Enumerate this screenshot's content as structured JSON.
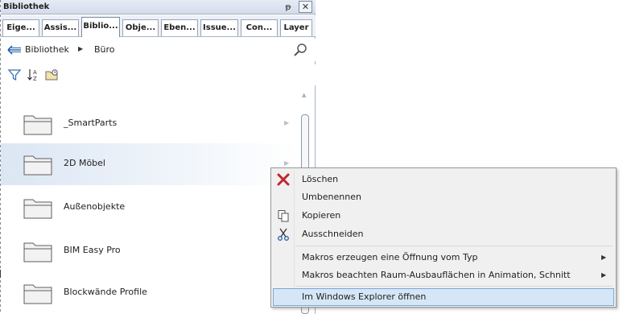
{
  "panel": {
    "title": "Bibliothek",
    "pin_glyph": "ᵽ",
    "close_glyph": "✕",
    "tabs": [
      {
        "label": "Eige...",
        "active": false
      },
      {
        "label": "Assis...",
        "active": false
      },
      {
        "label": "Biblio...",
        "active": true
      },
      {
        "label": "Obje...",
        "active": false
      },
      {
        "label": "Eben...",
        "active": false
      },
      {
        "label": "Issue...",
        "active": false
      },
      {
        "label": "Con...",
        "active": false
      },
      {
        "label": "Layer",
        "active": false
      }
    ]
  },
  "breadcrumb": {
    "items": [
      "Bibliothek",
      "Büro"
    ],
    "separator": "▶",
    "back_icon": "back-arrow-icon",
    "search_icon": "search-icon"
  },
  "toolbar": {
    "icons": [
      "filter-icon",
      "sort-icon",
      "folder-settings-icon"
    ]
  },
  "folders": [
    {
      "label": "_SmartParts",
      "hovered": false
    },
    {
      "label": "2D Möbel",
      "hovered": true
    },
    {
      "label": "Außenobjekte",
      "hovered": false
    },
    {
      "label": "BIM Easy Pro",
      "hovered": false
    },
    {
      "label": "Blockwände Profile",
      "hovered": false
    }
  ],
  "context_menu": {
    "items": [
      {
        "label": "Löschen",
        "icon": "delete-x-icon",
        "submenu": false,
        "selected": false
      },
      {
        "label": "Umbenennen",
        "icon": "",
        "submenu": false,
        "selected": false
      },
      {
        "label": "Kopieren",
        "icon": "copy-icon",
        "submenu": false,
        "selected": false
      },
      {
        "label": "Ausschneiden",
        "icon": "scissors-icon",
        "submenu": false,
        "selected": false
      },
      {
        "label": "Makros erzeugen eine Öffnung vom Typ",
        "icon": "",
        "submenu": true,
        "selected": false
      },
      {
        "label": "Makros beachten Raum-Ausbauflächen in Animation, Schnitt",
        "icon": "",
        "submenu": true,
        "selected": false
      },
      {
        "label": "Im Windows Explorer öffnen",
        "icon": "",
        "submenu": false,
        "selected": true
      }
    ],
    "submenu_glyph": "▶"
  },
  "colors": {
    "delete_red": "#c0262c",
    "selection": "#d5e6f7",
    "panel_border": "#a9b3c2"
  }
}
